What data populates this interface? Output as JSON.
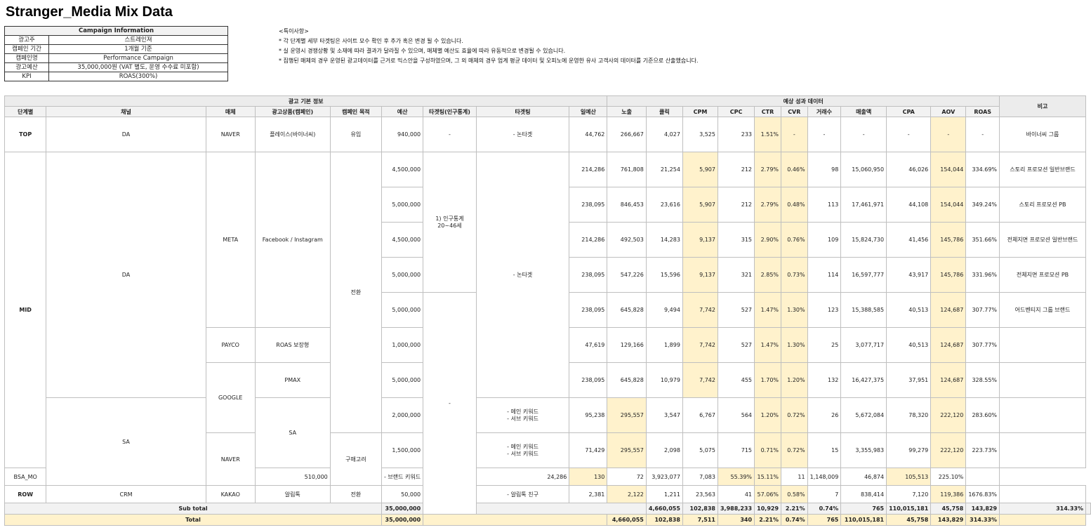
{
  "page": {
    "title": "Stranger_Media Mix Data"
  },
  "campaign": {
    "header": "Campaign Information",
    "rows": [
      {
        "k": "광고주",
        "v": "스트레인져"
      },
      {
        "k": "캠페인 기간",
        "v": "1개월 기준"
      },
      {
        "k": "캠페인명",
        "v": "Performance Campaign"
      },
      {
        "k": "광고예산",
        "v": "35,000,000원 (VAT 별도, 운영 수수료 미포함)"
      },
      {
        "k": "KPI",
        "v": "ROAS(300%)"
      }
    ]
  },
  "notes": {
    "title": "<특이사항>",
    "items": [
      "* 각 단계별 세부 타겟팅은 사이트 모수 확인 후 추가 혹은 변경 될 수 있습니다.",
      "* 실 운영시 경쟁상황 및 소재에 따라 결과가 달라질 수 있으며, 매체별 예산도 효율에 따라 유동적으로 변경될 수 있습니다.",
      "* 집행된 매체의 경우 운영된 광고데이터를 근거로 믹스안을 구성하였으며, 그 외 매체의 경우 업계 평균 데이터 및 오피노에 운영한 유사 고객사의 데이터를 기준으로 산출했습니다."
    ]
  },
  "table": {
    "groups": {
      "basic": "광고 기본 정보",
      "perf": "예상 성과 데이터",
      "note": "비고"
    },
    "headers": {
      "stage": "단계별",
      "channel": "채널",
      "media": "매체",
      "product": "광고상품(캠페인)",
      "purpose": "캠페인 목적",
      "budget": "예산",
      "demo": "타겟팅(인구통계)",
      "targeting": "타겟팅",
      "daily": "일예산",
      "imp": "노출",
      "click": "클릭",
      "cpm": "CPM",
      "cpc": "CPC",
      "ctr": "CTR",
      "cvr": "CVR",
      "tx": "거래수",
      "sales": "매출액",
      "cpa": "CPA",
      "aov": "AOV",
      "roas": "ROAS"
    },
    "labels": {
      "top": "TOP",
      "mid": "MID",
      "row": "ROW",
      "da": "DA",
      "sa": "SA",
      "crm": "CRM",
      "naver": "NAVER",
      "meta": "META",
      "payco": "PAYCO",
      "google": "GOOGLE",
      "kakao": "KAKAO",
      "place": "플레이스(바이너씨)",
      "fbig": "Facebook / Instagram",
      "roas_pro": "ROAS 보장형",
      "pmax": "PMAX",
      "sa_prod": "SA",
      "bsa": "BSA_MO",
      "alimtalk": "알림톡",
      "inflow": "유입",
      "conversion": "전환",
      "consider": "구매고려",
      "conversion2": "전환",
      "dash1": "-",
      "dash2": "-",
      "demo1": "1) 인구통계",
      "demo2": "20~46세",
      "nontarget1": "- 논타겟",
      "nontarget2": "- 논타겟",
      "kw1": "- 메인 키워드",
      "kw2": "- 서브 키워드",
      "kw3": "- 메인 키워드",
      "kw4": "- 서브 키워드",
      "brandkw": "- 브랜드 키워드",
      "friends": "- 알림톡 친구"
    },
    "rows": [
      {
        "budget": "940,000",
        "daily": "44,762",
        "imp": "266,667",
        "click": "4,027",
        "cpm": "3,525",
        "cpc": "233",
        "ctr": "1.51%",
        "cvr": "-",
        "tx": "-",
        "sales": "-",
        "cpa": "-",
        "aov": "-",
        "roas": "-",
        "note": "바이너씨 그룹"
      },
      {
        "budget": "4,500,000",
        "daily": "214,286",
        "imp": "761,808",
        "click": "21,254",
        "cpm": "5,907",
        "cpc": "212",
        "ctr": "2.79%",
        "cvr": "0.46%",
        "tx": "98",
        "sales": "15,060,950",
        "cpa": "46,026",
        "aov": "154,044",
        "roas": "334.69%",
        "note": "스토리 프로모션 일반브랜드"
      },
      {
        "budget": "5,000,000",
        "daily": "238,095",
        "imp": "846,453",
        "click": "23,616",
        "cpm": "5,907",
        "cpc": "212",
        "ctr": "2.79%",
        "cvr": "0.48%",
        "tx": "113",
        "sales": "17,461,971",
        "cpa": "44,108",
        "aov": "154,044",
        "roas": "349.24%",
        "note": "스토리 프로모션 PB"
      },
      {
        "budget": "4,500,000",
        "daily": "214,286",
        "imp": "492,503",
        "click": "14,283",
        "cpm": "9,137",
        "cpc": "315",
        "ctr": "2.90%",
        "cvr": "0.76%",
        "tx": "109",
        "sales": "15,824,730",
        "cpa": "41,456",
        "aov": "145,786",
        "roas": "351.66%",
        "note": "전체지면 프로모션 일반브랜드"
      },
      {
        "budget": "5,000,000",
        "daily": "238,095",
        "imp": "547,226",
        "click": "15,596",
        "cpm": "9,137",
        "cpc": "321",
        "ctr": "2.85%",
        "cvr": "0.73%",
        "tx": "114",
        "sales": "16,597,777",
        "cpa": "43,917",
        "aov": "145,786",
        "roas": "331.96%",
        "note": "전체지면 프로모션 PB"
      },
      {
        "budget": "5,000,000",
        "daily": "238,095",
        "imp": "645,828",
        "click": "9,494",
        "cpm": "7,742",
        "cpc": "527",
        "ctr": "1.47%",
        "cvr": "1.30%",
        "tx": "123",
        "sales": "15,388,585",
        "cpa": "40,513",
        "aov": "124,687",
        "roas": "307.77%",
        "note": "어드벤티지 그룹 브랜드"
      },
      {
        "budget": "1,000,000",
        "daily": "47,619",
        "imp": "129,166",
        "click": "1,899",
        "cpm": "7,742",
        "cpc": "527",
        "ctr": "1.47%",
        "cvr": "1.30%",
        "tx": "25",
        "sales": "3,077,717",
        "cpa": "40,513",
        "aov": "124,687",
        "roas": "307.77%",
        "note": ""
      },
      {
        "budget": "5,000,000",
        "daily": "238,095",
        "imp": "645,828",
        "click": "10,979",
        "cpm": "7,742",
        "cpc": "455",
        "ctr": "1.70%",
        "cvr": "1.20%",
        "tx": "132",
        "sales": "16,427,375",
        "cpa": "37,951",
        "aov": "124,687",
        "roas": "328.55%",
        "note": ""
      },
      {
        "budget": "2,000,000",
        "daily": "95,238",
        "imp": "295,557",
        "click": "3,547",
        "cpm": "6,767",
        "cpc": "564",
        "ctr": "1.20%",
        "cvr": "0.72%",
        "tx": "26",
        "sales": "5,672,084",
        "cpa": "78,320",
        "aov": "222,120",
        "roas": "283.60%",
        "note": ""
      },
      {
        "budget": "1,500,000",
        "daily": "71,429",
        "imp": "295,557",
        "click": "2,098",
        "cpm": "5,075",
        "cpc": "715",
        "ctr": "0.71%",
        "cvr": "0.72%",
        "tx": "15",
        "sales": "3,355,983",
        "cpa": "99,279",
        "aov": "222,120",
        "roas": "223.73%",
        "note": ""
      },
      {
        "budget": "510,000",
        "daily": "24,286",
        "imp": "130",
        "click": "72",
        "cpm": "3,923,077",
        "cpc": "7,083",
        "ctr": "55.39%",
        "cvr": "15.11%",
        "tx": "11",
        "sales": "1,148,009",
        "cpa": "46,874",
        "aov": "105,513",
        "roas": "225.10%",
        "note": ""
      },
      {
        "budget": "50,000",
        "daily": "2,381",
        "imp": "2,122",
        "click": "1,211",
        "cpm": "23,563",
        "cpc": "41",
        "ctr": "57.06%",
        "cvr": "0.58%",
        "tx": "7",
        "sales": "838,414",
        "cpa": "7,120",
        "aov": "119,386",
        "roas": "1676.83%",
        "note": ""
      }
    ],
    "subtotal": {
      "label": "Sub total",
      "budget": "35,000,000",
      "imp": "4,660,055",
      "click": "102,838",
      "cpm": "3,988,233",
      "cpc": "10,929",
      "ctr": "2.21%",
      "cvr": "0.74%",
      "tx": "765",
      "sales": "110,015,181",
      "cpa": "45,758",
      "aov": "143,829",
      "roas": "314.33%"
    },
    "total": {
      "label": "Total",
      "budget": "35,000,000",
      "imp": "4,660,055",
      "click": "102,838",
      "cpm": "7,511",
      "cpc": "340",
      "ctr": "2.21%",
      "cvr": "0.74%",
      "tx": "765",
      "sales": "110,015,181",
      "cpa": "45,758",
      "aov": "143,829",
      "roas": "314.33%"
    }
  }
}
